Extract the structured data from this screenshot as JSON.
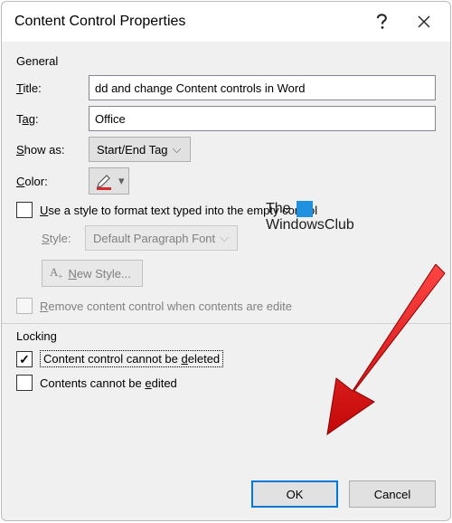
{
  "titlebar": {
    "title": "Content Control Properties"
  },
  "general": {
    "heading": "General",
    "title_label": "Title:",
    "title_value": "dd and change Content controls in Word",
    "tag_label": "Tag:",
    "tag_value": "Office",
    "showas_label": "Show as:",
    "showas_value": "Start/End Tag",
    "color_label": "Color:",
    "use_style_label": "Use a style to format text typed into the empty control",
    "style_label": "Style:",
    "style_value": "Default Paragraph Font",
    "new_style_label": "New Style...",
    "remove_label": "Remove content control when contents are edite"
  },
  "locking": {
    "heading": "Locking",
    "cannot_delete": "Content control cannot be deleted",
    "cannot_edit": "Contents cannot be edited"
  },
  "footer": {
    "ok": "OK",
    "cancel": "Cancel"
  },
  "watermark": {
    "line1": "The",
    "line2": "WindowsClub"
  }
}
